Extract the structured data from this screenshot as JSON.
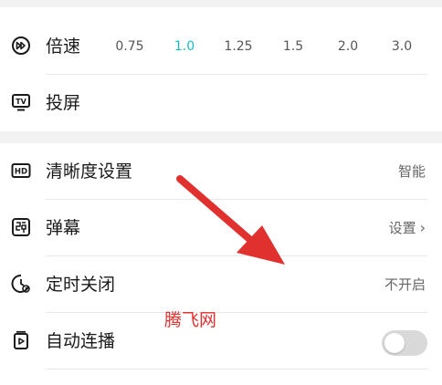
{
  "playback": {
    "speed_label": "倍速",
    "speeds": [
      "0.75",
      "1.0",
      "1.25",
      "1.5",
      "2.0",
      "3.0"
    ],
    "active_speed": "1.0",
    "cast_label": "投屏"
  },
  "settings": {
    "quality_label": "清晰度设置",
    "quality_value": "智能",
    "danmaku_label": "弹幕",
    "danmaku_value": "设置",
    "timer_label": "定时关闭",
    "timer_value": "不开启",
    "autoplay_label": "自动连播",
    "autoplay_on": false
  },
  "icons": {
    "speed": "speed-icon",
    "cast": "tv-icon",
    "quality": "hd-icon",
    "danmaku": "danmaku-icon",
    "timer": "timer-icon",
    "autoplay": "autoplay-icon"
  },
  "colors": {
    "accent": "#19b8c6",
    "annotation_red": "#e0312f"
  },
  "watermark": "腾飞网"
}
